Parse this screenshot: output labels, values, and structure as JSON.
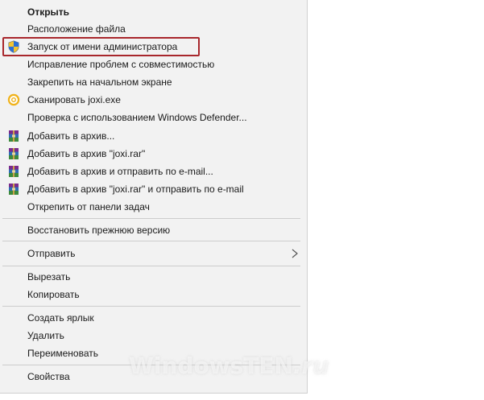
{
  "menu": {
    "open": "Открыть",
    "file_location": "Расположение файла",
    "run_as_admin": "Запуск от имени администратора",
    "troubleshoot_compat": "Исправление проблем с совместимостью",
    "pin_start": "Закрепить на начальном экране",
    "scan_joxi": "Сканировать joxi.exe",
    "scan_defender": "Проверка с использованием Windows Defender...",
    "add_archive": "Добавить в архив...",
    "add_joxi_rar": "Добавить в архив \"joxi.rar\"",
    "add_archive_email": "Добавить в архив и отправить по e-mail...",
    "add_joxi_rar_email": "Добавить в архив \"joxi.rar\" и отправить по e-mail",
    "unpin_taskbar": "Открепить от панели задач",
    "restore_prev": "Восстановить прежнюю версию",
    "send_to": "Отправить",
    "cut": "Вырезать",
    "copy": "Копировать",
    "create_shortcut": "Создать ярлык",
    "delete": "Удалить",
    "rename": "Переименовать",
    "properties": "Свойства"
  },
  "watermark": {
    "brand": "WindowsTEN",
    "suffix": ".ru"
  },
  "colors": {
    "menu_bg": "#f2f2f2",
    "highlight_border": "#a8272c",
    "separator": "#cccccc",
    "joxi_icon": "#f0b21a"
  },
  "icons": {
    "run_as_admin": "uac-shield-icon",
    "scan_joxi": "joxi-icon",
    "archive": "winrar-archive-icon",
    "send_to": "chevron-right-icon"
  }
}
